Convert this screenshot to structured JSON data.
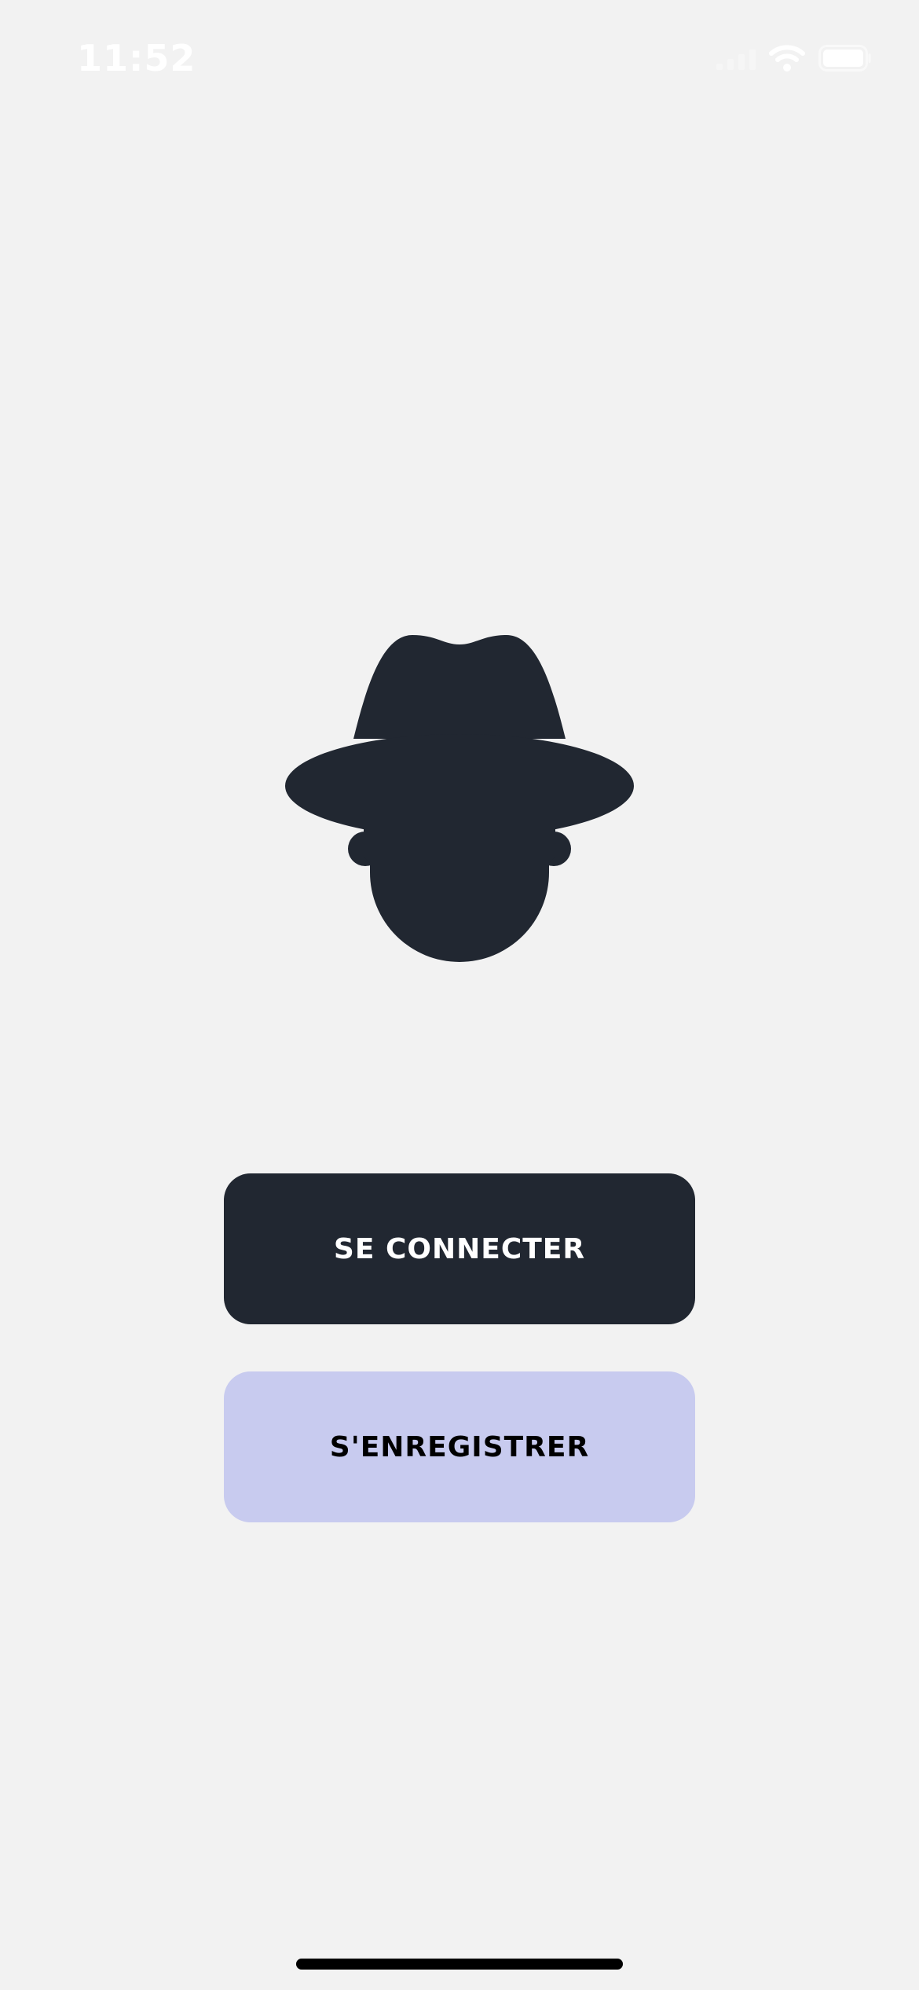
{
  "status_bar": {
    "time": "11:52",
    "signal_icon": "cellular-signal-icon",
    "wifi_icon": "wifi-icon",
    "battery_icon": "battery-icon"
  },
  "logo": {
    "icon": "spy-hat-silhouette-icon",
    "color": "#212731"
  },
  "actions": {
    "login_label": "SE CONNECTER",
    "register_label": "S'ENREGISTRER"
  },
  "colors": {
    "background": "#f2f2f2",
    "primary": "#212731",
    "secondary": "#c8cbef"
  }
}
